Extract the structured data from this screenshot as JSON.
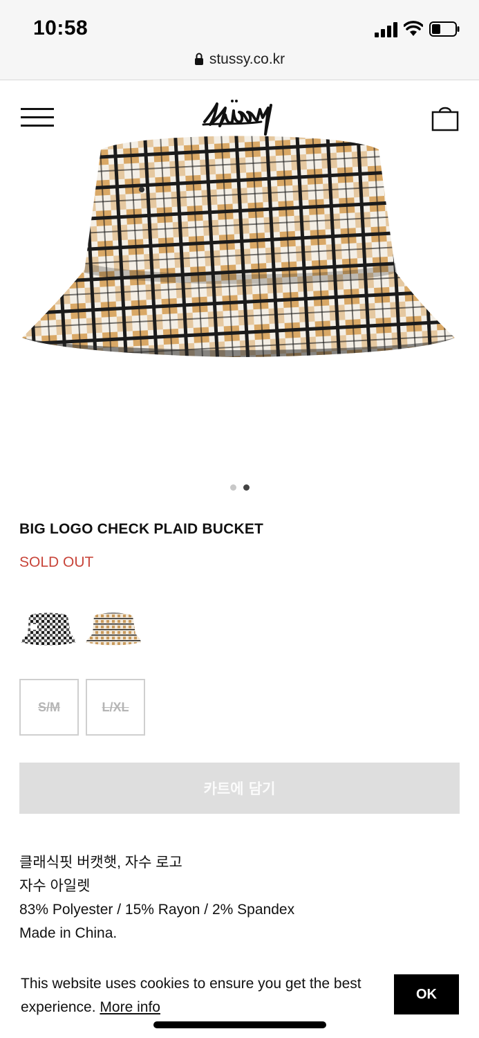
{
  "status_bar": {
    "time": "10:58",
    "signal_icon": "cellular-signal-icon",
    "wifi_icon": "wifi-icon",
    "battery_icon": "battery-low-icon"
  },
  "address_bar": {
    "url": "stussy.co.kr",
    "lock_icon": "lock-icon"
  },
  "header": {
    "menu_icon": "hamburger-menu-icon",
    "logo_icon": "stussy-logo",
    "cart_icon": "shopping-bag-icon"
  },
  "gallery": {
    "image_icon": "plaid-bucket-hat-image",
    "slide_count": 2,
    "active_slide": 2
  },
  "product": {
    "title": "BIG LOGO CHECK PLAID BUCKET",
    "status": "SOLD OUT",
    "status_color": "#c8453a",
    "color_swatches": [
      {
        "icon": "black-white-check-hat-swatch"
      },
      {
        "icon": "tan-check-hat-swatch"
      }
    ],
    "sizes": [
      "S/M",
      "L/XL"
    ],
    "add_to_cart_label": "카트에 담기",
    "description": [
      "클래식핏 버캣햇, 자수 로고",
      "자수 아일렛",
      "83% Polyester / 15% Rayon / 2% Spandex",
      "Made in China."
    ]
  },
  "cookie_banner": {
    "text": "This website uses cookies to ensure you get the best experience.",
    "link_label": "More info",
    "ok_label": "OK"
  }
}
